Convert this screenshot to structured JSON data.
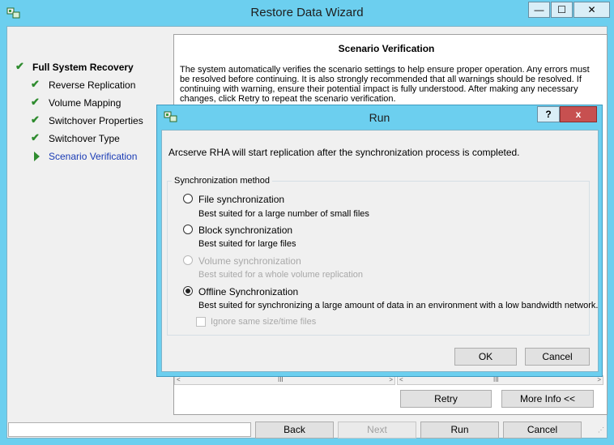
{
  "window": {
    "title": "Restore Data Wizard",
    "min_glyph": "—",
    "max_glyph": "☐",
    "close_glyph": "✕"
  },
  "steps": [
    {
      "label": "Full System Recovery",
      "state": "done",
      "main": true
    },
    {
      "label": "Reverse Replication",
      "state": "done",
      "main": false
    },
    {
      "label": "Volume Mapping",
      "state": "done",
      "main": false
    },
    {
      "label": "Switchover Properties",
      "state": "done",
      "main": false
    },
    {
      "label": "Switchover Type",
      "state": "done",
      "main": false
    },
    {
      "label": "Scenario Verification",
      "state": "active",
      "main": false
    }
  ],
  "panel": {
    "title": "Scenario Verification",
    "description": "The system automatically verifies the scenario settings to help ensure proper operation. Any errors must be resolved before continuing. It is also strongly recommended that all warnings should be resolved. If continuing with warning, ensure their potential impact is fully understood. After making any necessary changes, click Retry to repeat the scenario verification.",
    "scroll_grip": "III",
    "retry_label": "Retry",
    "more_info_label": "More Info <<"
  },
  "footer": {
    "back": "Back",
    "next": "Next",
    "run": "Run",
    "cancel": "Cancel"
  },
  "dialog": {
    "title": "Run",
    "help_glyph": "?",
    "close_glyph": "x",
    "message": "Arcserve RHA will start replication after the synchronization process is completed.",
    "group_label": "Synchronization method",
    "options": [
      {
        "label": "File synchronization",
        "desc": "Best suited for a large number of small files",
        "selected": false,
        "enabled": true
      },
      {
        "label": "Block synchronization",
        "desc": "Best suited for large files",
        "selected": false,
        "enabled": true
      },
      {
        "label": "Volume synchronization",
        "desc": "Best suited for a whole volume replication",
        "selected": false,
        "enabled": false
      },
      {
        "label": "Offline Synchronization",
        "desc": "Best suited for synchronizing a large amount of data in an environment with a low bandwidth network.",
        "selected": true,
        "enabled": true
      }
    ],
    "ignore_label": "Ignore same size/time files",
    "ignore_checked": false,
    "ok": "OK",
    "cancel": "Cancel"
  }
}
